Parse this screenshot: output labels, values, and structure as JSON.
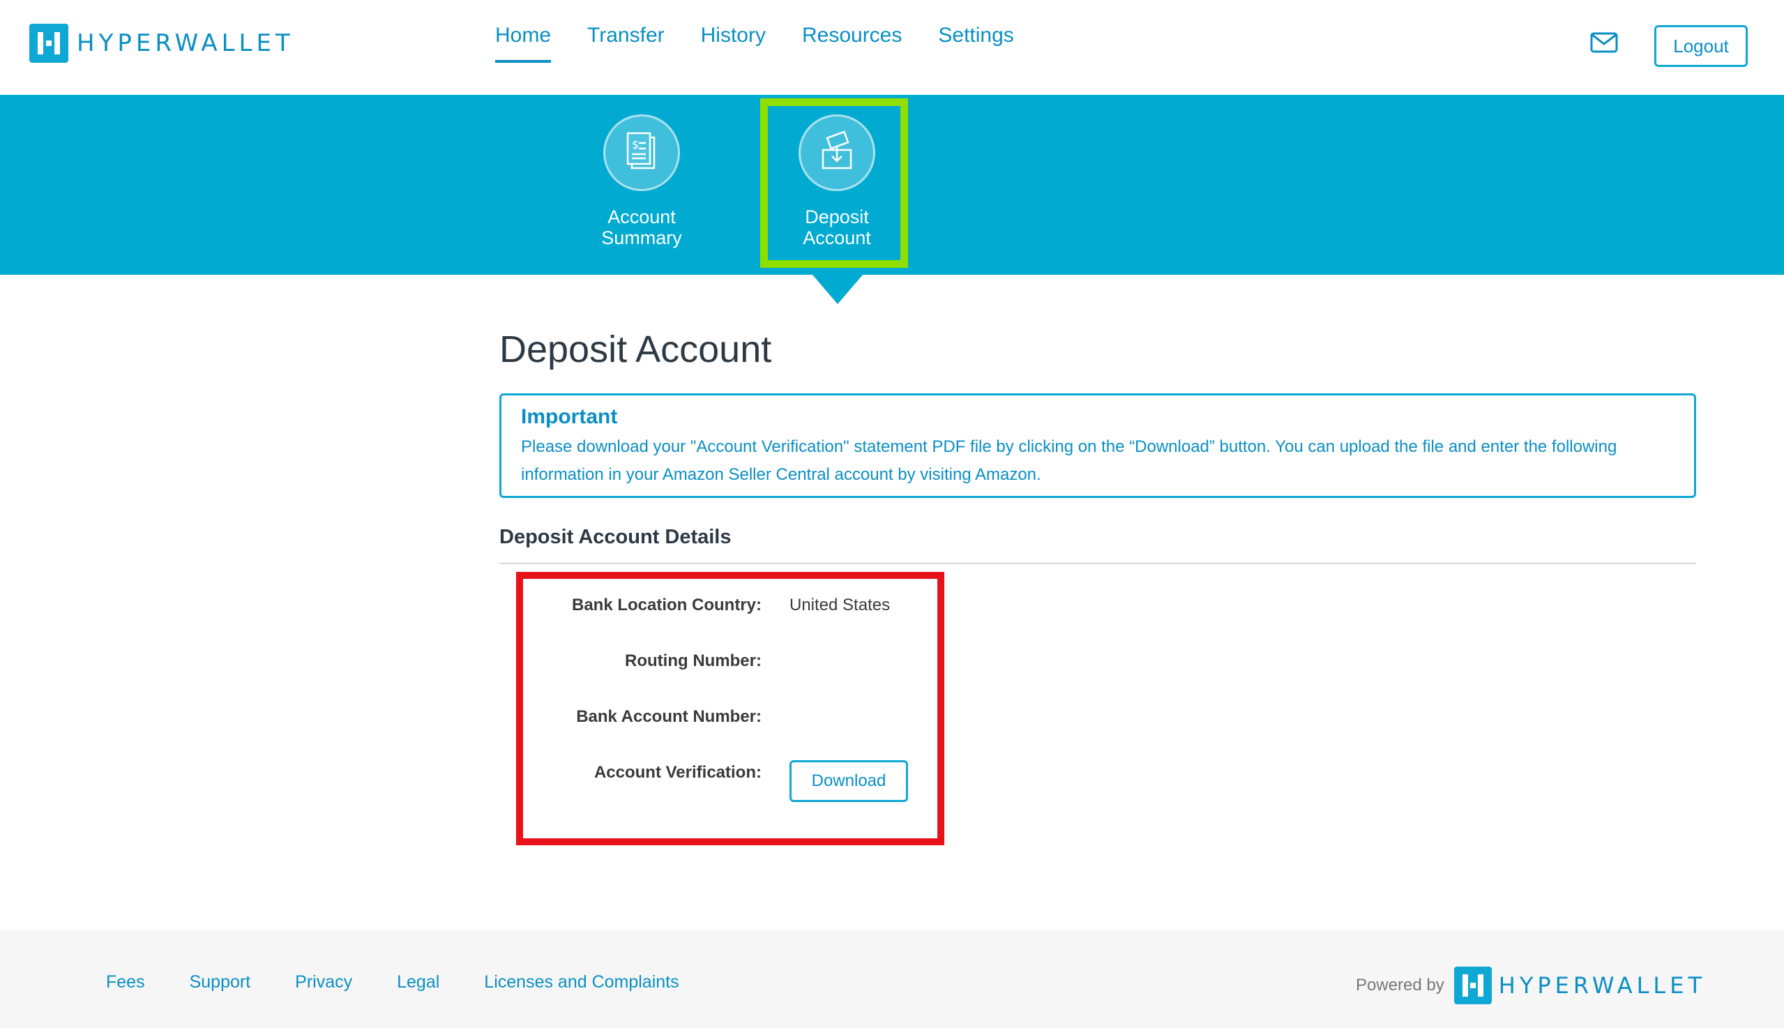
{
  "header": {
    "logo_text": "HYPERWALLET",
    "nav": [
      "Home",
      "Transfer",
      "History",
      "Resources",
      "Settings"
    ],
    "active_nav": "Home",
    "mail_icon": "mail-icon",
    "logout_label": "Logout"
  },
  "band": {
    "tiles": [
      {
        "line1": "Account",
        "line2": "Summary",
        "icon": "document-dollar-icon"
      },
      {
        "line1": "Deposit",
        "line2": "Account",
        "icon": "deposit-icon"
      }
    ],
    "highlight_color": "#8fe000",
    "background_color": "#00aad0"
  },
  "main": {
    "title": "Deposit Account",
    "alert": {
      "title": "Important",
      "text": "Please download your \"Account Verification\" statement PDF file by clicking on the “Download” button. You can upload the file and enter the following information in your Amazon Seller Central account by visiting Amazon."
    },
    "details_title": "Deposit Account Details",
    "rows": [
      {
        "label": "Bank Location Country:",
        "value": "United States"
      },
      {
        "label": "Routing Number:",
        "value": ""
      },
      {
        "label": "Bank Account Number:",
        "value": ""
      },
      {
        "label": "Account Verification:",
        "value": ""
      }
    ],
    "download_label": "Download",
    "highlight_color": "#e8121b"
  },
  "footer": {
    "links": [
      "Fees",
      "Support",
      "Privacy",
      "Legal",
      "Licenses and Complaints"
    ],
    "powered_by": "Powered by",
    "logo_text": "HYPERWALLET"
  }
}
